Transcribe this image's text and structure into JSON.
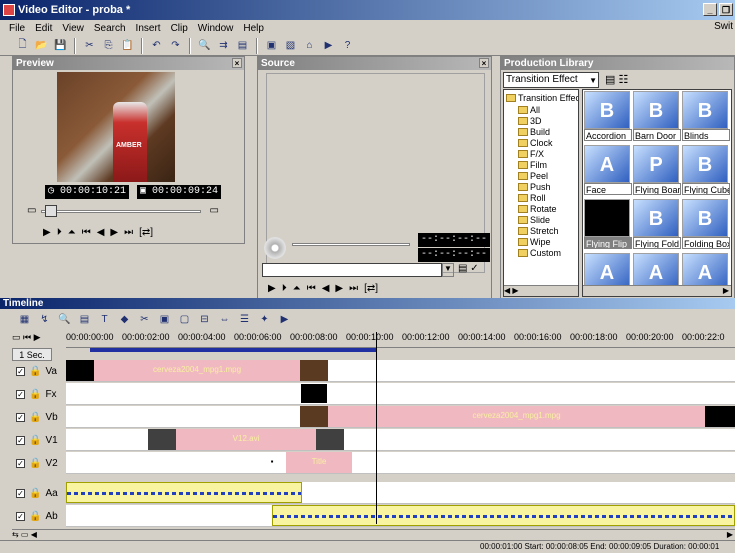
{
  "window": {
    "title": "Video Editor - proba *"
  },
  "menu": [
    "File",
    "Edit",
    "View",
    "Search",
    "Insert",
    "Clip",
    "Window",
    "Help"
  ],
  "menu_right": "Swit",
  "preview": {
    "title": "Preview",
    "timecode_current": "00:00:10:21",
    "timecode_duration": "00:00:09:24",
    "bottle_label": "AMBER"
  },
  "source": {
    "title": "Source",
    "timecode_in": "--:--:--:--",
    "timecode_out": "--:--:--:--"
  },
  "library": {
    "title": "Production Library",
    "category": "Transition Effect",
    "tree_root": "Transition Effect",
    "folders": [
      "All",
      "3D",
      "Build",
      "Clock",
      "F/X",
      "Film",
      "Peel",
      "Push",
      "Roll",
      "Rotate",
      "Slide",
      "Stretch",
      "Wipe",
      "Custom"
    ],
    "items": [
      {
        "label": "Accordion",
        "letter": "B"
      },
      {
        "label": "Barn Door",
        "letter": "B"
      },
      {
        "label": "Blinds",
        "letter": "B"
      },
      {
        "label": "Face",
        "letter": "A"
      },
      {
        "label": "Flying Board",
        "letter": "P"
      },
      {
        "label": "Flying Cube",
        "letter": "B"
      },
      {
        "label": "Flying Flip",
        "letter": ""
      },
      {
        "label": "Flying Fold",
        "letter": "B"
      },
      {
        "label": "Folding Box",
        "letter": "B"
      },
      {
        "label": "",
        "letter": "A"
      },
      {
        "label": "",
        "letter": "A"
      },
      {
        "label": "",
        "letter": "A"
      }
    ]
  },
  "timeline": {
    "title": "Timeline",
    "zoom_label": "1 Sec.",
    "ruler": [
      "00:00:00:00",
      "00:00:02:00",
      "00:00:04:00",
      "00:00:06:00",
      "00:00:08:00",
      "00:00:10:00",
      "00:00:12:00",
      "00:00:14:00",
      "00:00:16:00",
      "00:00:18:00",
      "00:00:20:00",
      "00:00:22:0"
    ],
    "tracks": [
      {
        "name": "Va",
        "clip": "cerveza2004_mpg1.mpg"
      },
      {
        "name": "Fx",
        "clip": ""
      },
      {
        "name": "Vb",
        "clip": "cerveza2004_mpg1.mpg"
      },
      {
        "name": "V1",
        "clip": "V12.avi"
      },
      {
        "name": "V2",
        "clip": "Title"
      },
      {
        "name": "Aa",
        "clip": ""
      },
      {
        "name": "Ab",
        "clip": ""
      }
    ]
  },
  "status": "00:00:01:00  Start: 00:00:08:05  End: 00:00:09:05  Duration: 00:00:01"
}
